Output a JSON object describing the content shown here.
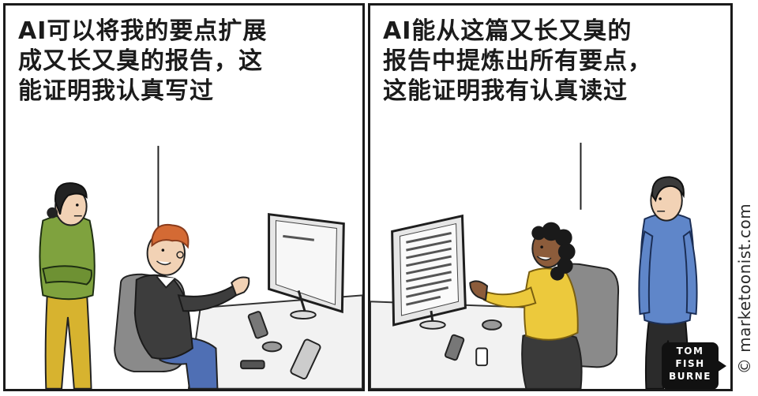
{
  "panels": {
    "left": {
      "caption_lines": [
        "AI可以将我的要点扩展",
        "成又长又臭的报告，这",
        "能证明我认真写过"
      ]
    },
    "right": {
      "caption_lines": [
        "AI能从这篇又长又臭的",
        "报告中提炼出所有要点，",
        "这能证明我有认真读过"
      ]
    }
  },
  "credit": {
    "site": "© marketoonist.com",
    "signature_lines": [
      "TOM",
      "FISH",
      "BURNE"
    ]
  },
  "colors": {
    "green_top": "#7fa23e",
    "mustard": "#d7b32f",
    "yellow_top": "#ecc93c",
    "blue_shirt": "#5f86c9",
    "dark_sweater": "#3d3d3d",
    "skin": "#f2d2b5",
    "skin_dark": "#8c5c3b",
    "hair_red": "#d46a34",
    "monitor": "#e6e6e6",
    "desk": "#f2f2f2"
  }
}
